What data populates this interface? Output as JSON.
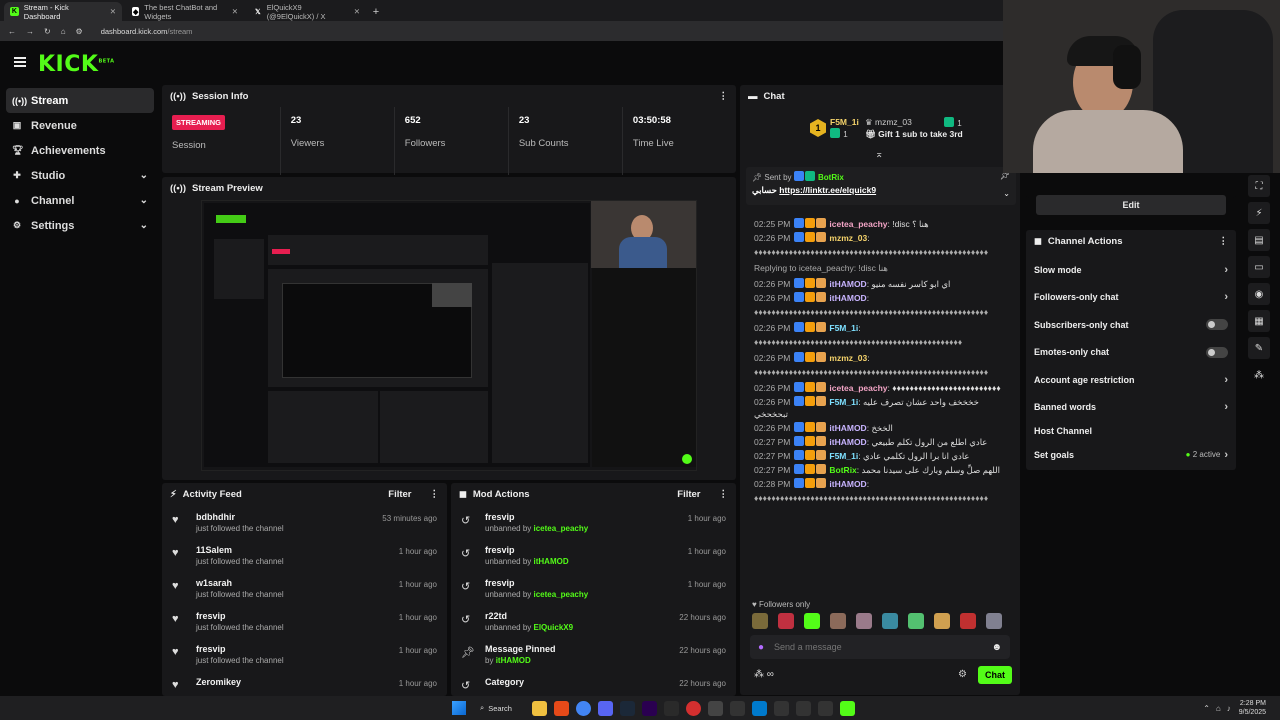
{
  "browser": {
    "tabs": [
      {
        "label": "Stream - Kick Dashboard",
        "active": true
      },
      {
        "label": "The best ChatBot and Widgets",
        "active": false
      },
      {
        "label": "ElQuickX9 (@9ElQuickX) / X",
        "active": false
      }
    ],
    "url_host": "dashboard.kick.com",
    "url_path": "/stream"
  },
  "brand": {
    "logo": "KICK",
    "beta": "BETA",
    "accent": "#53fc18"
  },
  "sidebar": {
    "items": [
      {
        "label": "Stream",
        "icon": "broadcast-icon",
        "active": true
      },
      {
        "label": "Revenue",
        "icon": "wallet-icon"
      },
      {
        "label": "Achievements",
        "icon": "trophy-icon"
      },
      {
        "label": "Studio",
        "icon": "studio-icon",
        "expandable": true
      },
      {
        "label": "Channel",
        "icon": "channel-icon",
        "expandable": true
      },
      {
        "label": "Settings",
        "icon": "gear-icon",
        "expandable": true
      }
    ]
  },
  "session": {
    "title": "Session Info",
    "status": "STREAMING",
    "status_label": "Session",
    "stats": [
      {
        "value": "23",
        "label": "Viewers"
      },
      {
        "value": "652",
        "label": "Followers"
      },
      {
        "value": "23",
        "label": "Sub Counts"
      },
      {
        "value": "03:50:58",
        "label": "Time Live"
      }
    ]
  },
  "preview": {
    "title": "Stream Preview"
  },
  "activity": {
    "title": "Activity Feed",
    "filter": "Filter",
    "items": [
      {
        "name": "bdbhdhir",
        "sub": "just followed the channel",
        "time": "53 minutes ago"
      },
      {
        "name": "11Salem",
        "sub": "just followed the channel",
        "time": "1 hour ago"
      },
      {
        "name": "w1sarah",
        "sub": "just followed the channel",
        "time": "1 hour ago"
      },
      {
        "name": "fresvip",
        "sub": "just followed the channel",
        "time": "1 hour ago"
      },
      {
        "name": "fresvip",
        "sub": "just followed the channel",
        "time": "1 hour ago"
      },
      {
        "name": "Zeromikey",
        "sub": "",
        "time": "1 hour ago"
      }
    ]
  },
  "mod": {
    "title": "Mod Actions",
    "filter": "Filter",
    "items": [
      {
        "name": "fresvip",
        "action": "unbanned by",
        "by": "icetea_peachy",
        "time": "1 hour ago",
        "icon": "undo-icon"
      },
      {
        "name": "fresvip",
        "action": "unbanned by",
        "by": "itHAMOD",
        "time": "1 hour ago",
        "icon": "undo-icon"
      },
      {
        "name": "fresvip",
        "action": "unbanned by",
        "by": "icetea_peachy",
        "time": "1 hour ago",
        "icon": "undo-icon"
      },
      {
        "name": "r22td",
        "action": "unbanned by",
        "by": "ElQuickX9",
        "time": "22 hours ago",
        "icon": "undo-icon"
      },
      {
        "name": "Message Pinned",
        "action": "by",
        "by": "itHAMOD",
        "time": "22 hours ago",
        "icon": "pin-icon"
      },
      {
        "name": "Category",
        "action": "",
        "by": "",
        "time": "22 hours ago",
        "icon": "undo-icon"
      }
    ]
  },
  "chat": {
    "title": "Chat",
    "leaders": [
      {
        "name": "F5M_1i",
        "count": "1"
      },
      {
        "name": "mzmz_03",
        "count": "1"
      }
    ],
    "gift_text": "Gift 1 sub to take 3rd",
    "pinned": {
      "sent_by": "Sent by",
      "bot": "BotRix",
      "prefix": "حسابي",
      "link": "https://linktr.ee/elquick9"
    },
    "messages": [
      {
        "time": "02:25 PM",
        "user": "icetea_peachy",
        "color": "#f3a5c6",
        "text": "!disc هنا ؟"
      },
      {
        "time": "02:26 PM",
        "user": "mzmz_03",
        "color": "#f5d36b",
        "text": ""
      },
      {
        "time": "",
        "user": "",
        "color": "",
        "text": "♦♦♦♦♦♦♦♦♦♦♦♦♦♦♦♦♦♦♦♦♦♦♦♦♦♦♦♦♦♦♦♦♦♦♦♦♦♦♦♦♦♦♦♦♦♦♦♦♦♦♦♦♦♦"
      },
      {
        "time": "",
        "user": "",
        "color": "",
        "text": "Replying to icetea_peachy: !disc هنا"
      },
      {
        "time": "02:26 PM",
        "user": "itHAMOD",
        "color": "#c8b4ff",
        "text": "اي ابو كاسر نفسه منيو"
      },
      {
        "time": "02:26 PM",
        "user": "itHAMOD",
        "color": "#c8b4ff",
        "text": ""
      },
      {
        "time": "",
        "user": "",
        "color": "",
        "text": "♦♦♦♦♦♦♦♦♦♦♦♦♦♦♦♦♦♦♦♦♦♦♦♦♦♦♦♦♦♦♦♦♦♦♦♦♦♦♦♦♦♦♦♦♦♦♦♦♦♦♦♦♦♦"
      },
      {
        "time": "02:26 PM",
        "user": "F5M_1i",
        "color": "#7ee0ff",
        "text": ""
      },
      {
        "time": "",
        "user": "",
        "color": "",
        "text": "♦♦♦♦♦♦♦♦♦♦♦♦♦♦♦♦♦♦♦♦♦♦♦♦♦♦♦♦♦♦♦♦♦♦♦♦♦♦♦♦♦♦♦♦♦♦♦♦"
      },
      {
        "time": "02:26 PM",
        "user": "mzmz_03",
        "color": "#f5d36b",
        "text": ""
      },
      {
        "time": "",
        "user": "",
        "color": "",
        "text": "♦♦♦♦♦♦♦♦♦♦♦♦♦♦♦♦♦♦♦♦♦♦♦♦♦♦♦♦♦♦♦♦♦♦♦♦♦♦♦♦♦♦♦♦♦♦♦♦♦♦♦♦♦♦"
      },
      {
        "time": "02:26 PM",
        "user": "icetea_peachy",
        "color": "#f3a5c6",
        "text": "♦♦♦♦♦♦♦♦♦♦♦♦♦♦♦♦♦♦♦♦♦♦♦♦♦"
      },
      {
        "time": "02:26 PM",
        "user": "F5M_1i",
        "color": "#7ee0ff",
        "text": "خخخخف واحد عشان تصرف عليه تبحخحخي"
      },
      {
        "time": "02:26 PM",
        "user": "itHAMOD",
        "color": "#c8b4ff",
        "text": "الخخخ"
      },
      {
        "time": "02:27 PM",
        "user": "itHAMOD",
        "color": "#c8b4ff",
        "text": "عادي اطلع من الرول تكلم طبيعي"
      },
      {
        "time": "02:27 PM",
        "user": "F5M_1i",
        "color": "#7ee0ff",
        "text": "عادي انا برا الرول تكلمي عادي"
      },
      {
        "time": "02:27 PM",
        "user": "BotRix",
        "color": "#53fc18",
        "text": "اللهم صلِّ وسلم وبارك على سيدنا محمد"
      },
      {
        "time": "02:28 PM",
        "user": "itHAMOD",
        "color": "#c8b4ff",
        "text": ""
      },
      {
        "time": "",
        "user": "",
        "color": "",
        "text": "♦♦♦♦♦♦♦♦♦♦♦♦♦♦♦♦♦♦♦♦♦♦♦♦♦♦♦♦♦♦♦♦♦♦♦♦♦♦♦♦♦♦♦♦♦♦♦♦♦♦♦♦♦♦"
      }
    ],
    "followers_only": "Followers only",
    "placeholder": "Send a message",
    "send": "Chat"
  },
  "channel_actions": {
    "edit": "Edit",
    "title": "Channel Actions",
    "items": [
      {
        "label": "Slow mode",
        "type": "chevron"
      },
      {
        "label": "Followers-only chat",
        "type": "chevron"
      },
      {
        "label": "Subscribers-only chat",
        "type": "toggle"
      },
      {
        "label": "Emotes-only chat",
        "type": "toggle"
      },
      {
        "label": "Account age restriction",
        "type": "chevron"
      },
      {
        "label": "Banned words",
        "type": "chevron"
      },
      {
        "label": "Host Channel",
        "type": "none"
      },
      {
        "label": "Set goals",
        "type": "chevron",
        "extra": "2 active"
      }
    ]
  },
  "taskbar": {
    "search": "Search",
    "time": "2:28 PM",
    "date": "9/5/2025"
  }
}
